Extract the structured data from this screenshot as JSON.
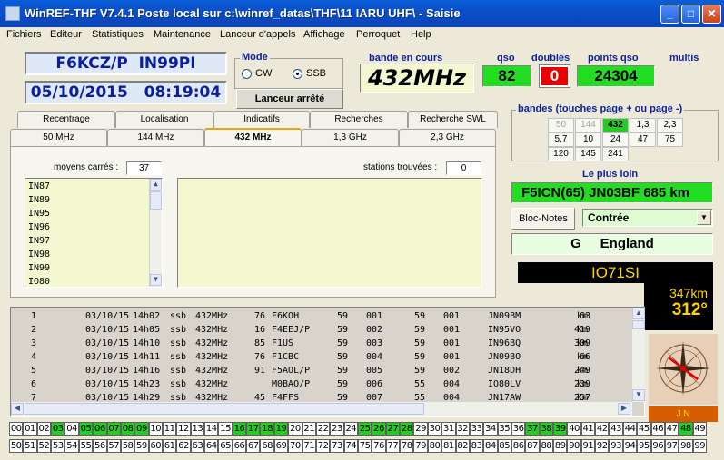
{
  "window": {
    "title": "WinREF-THF V7.4.1 Poste local sur c:\\winref_datas\\THF\\11 IARU UHF\\ -   Saisie",
    "minimize": "_",
    "maximize": "□",
    "close": "✕"
  },
  "menu": [
    "Fichiers",
    "Editeur",
    "Statistiques",
    "Maintenance",
    "Lanceur d'appels",
    "Affichage",
    "Perroquet",
    "Help"
  ],
  "station": {
    "callsign": "F6KCZ/P",
    "locator": "IN99PI",
    "date": "05/10/2015",
    "time": "08:19:04"
  },
  "mode": {
    "label": "Mode",
    "options": [
      "CW",
      "SSB"
    ],
    "selected": "SSB"
  },
  "launcher_status": "Lanceur arrêté",
  "band_current": {
    "label": "bande en cours",
    "value": "432MHz"
  },
  "qso": {
    "label": "qso",
    "value": "82"
  },
  "doubles": {
    "label": "doubles",
    "value": "0"
  },
  "points": {
    "label": "points qso",
    "value": "24304"
  },
  "multis": {
    "label": "multis"
  },
  "tabs_row1": [
    "Recentrage",
    "Localisation",
    "Indicatifs",
    "Recherches",
    "Recherche SWL"
  ],
  "tabs_row2": [
    "50 MHz",
    "144 MHz",
    "432 MHz",
    "1,3 GHz",
    "2,3 GHz"
  ],
  "active_tab": "432 MHz",
  "squares": {
    "label": "moyens carrés :",
    "count": "37",
    "items": [
      "IN87",
      "IN89",
      "IN95",
      "IN96",
      "IN97",
      "IN98",
      "IN99",
      "IO80"
    ]
  },
  "stations": {
    "label": "stations trouvées :",
    "count": "0"
  },
  "bands": {
    "label": "bandes (touches page + ou page -)",
    "cells": [
      {
        "v": "50",
        "state": "dim"
      },
      {
        "v": "144",
        "state": "dim"
      },
      {
        "v": "432",
        "state": "sel"
      },
      {
        "v": "1,3",
        "state": ""
      },
      {
        "v": "2,3",
        "state": ""
      },
      {
        "v": "5,7",
        "state": ""
      },
      {
        "v": "10",
        "state": ""
      },
      {
        "v": "24",
        "state": ""
      },
      {
        "v": "47",
        "state": ""
      },
      {
        "v": "75",
        "state": ""
      },
      {
        "v": "120",
        "state": ""
      },
      {
        "v": "145",
        "state": ""
      },
      {
        "v": "241",
        "state": ""
      }
    ]
  },
  "farthest": {
    "label": "Le plus loin",
    "value": "F5ICN(65) JN03BF  685 km"
  },
  "notes_button": "Bloc-Notes",
  "contest_select": "Contrée",
  "country": "G     England",
  "target": {
    "locator": "IO71SI",
    "distance": "347km",
    "bearing": "312°"
  },
  "compass_label": "J N",
  "log": [
    {
      "n": "1",
      "date": "03/10/15",
      "time": "14h02",
      "mode": "ssb",
      "band": "432MHz",
      "dx": "76",
      "call": "F6KOH",
      "rs": "59",
      "ns": "001",
      "rr": "59",
      "nr": "001",
      "loc": "JN09BM",
      "km": "63",
      "unit": "km"
    },
    {
      "n": "2",
      "date": "03/10/15",
      "time": "14h05",
      "mode": "ssb",
      "band": "432MHz",
      "dx": "16",
      "call": "F4EEJ/P",
      "rs": "59",
      "ns": "002",
      "rr": "59",
      "nr": "001",
      "loc": "IN95VO",
      "km": "419",
      "unit": "km"
    },
    {
      "n": "3",
      "date": "03/10/15",
      "time": "14h10",
      "mode": "ssb",
      "band": "432MHz",
      "dx": "85",
      "call": "F1US",
      "rs": "59",
      "ns": "003",
      "rr": "59",
      "nr": "001",
      "loc": "IN96BQ",
      "km": "309",
      "unit": "km"
    },
    {
      "n": "4",
      "date": "03/10/15",
      "time": "14h11",
      "mode": "ssb",
      "band": "432MHz",
      "dx": "76",
      "call": "F1CBC",
      "rs": "59",
      "ns": "004",
      "rr": "59",
      "nr": "001",
      "loc": "JN09BO",
      "km": "66",
      "unit": "km"
    },
    {
      "n": "5",
      "date": "03/10/15",
      "time": "14h16",
      "mode": "ssb",
      "band": "432MHz",
      "dx": "91",
      "call": "F5AOL/P",
      "rs": "59",
      "ns": "005",
      "rr": "59",
      "nr": "002",
      "loc": "JN18DH",
      "km": "249",
      "unit": "km"
    },
    {
      "n": "6",
      "date": "03/10/15",
      "time": "14h23",
      "mode": "ssb",
      "band": "432MHz",
      "dx": "",
      "call": "M0BAO/P",
      "rs": "59",
      "ns": "006",
      "rr": "55",
      "nr": "004",
      "loc": "IO80LV",
      "km": "239",
      "unit": "km"
    },
    {
      "n": "7",
      "date": "03/10/15",
      "time": "14h29",
      "mode": "ssb",
      "band": "432MHz",
      "dx": "45",
      "call": "F4FFS",
      "rs": "59",
      "ns": "007",
      "rr": "55",
      "nr": "004",
      "loc": "JN17AW",
      "km": "257",
      "unit": "km"
    }
  ],
  "dept_on": [
    "03",
    "05",
    "06",
    "07",
    "08",
    "09",
    "16",
    "17",
    "18",
    "19",
    "25",
    "26",
    "27",
    "28",
    "37",
    "38",
    "39",
    "48"
  ],
  "dept_row1": [
    "00",
    "01",
    "02",
    "03",
    "04",
    "05",
    "06",
    "07",
    "08",
    "09",
    "10",
    "11",
    "12",
    "13",
    "14",
    "15",
    "16",
    "17",
    "18",
    "19",
    "20",
    "21",
    "22",
    "23",
    "24",
    "25",
    "26",
    "27",
    "28",
    "29",
    "30",
    "31",
    "32",
    "33",
    "34",
    "35",
    "36",
    "37",
    "38",
    "39",
    "40",
    "41",
    "42",
    "43",
    "44",
    "45",
    "46",
    "47",
    "48",
    "49"
  ],
  "dept_row2": [
    "50",
    "51",
    "52",
    "53",
    "54",
    "55",
    "56",
    "57",
    "58",
    "59",
    "60",
    "61",
    "62",
    "63",
    "64",
    "65",
    "66",
    "67",
    "68",
    "69",
    "70",
    "71",
    "72",
    "73",
    "74",
    "75",
    "76",
    "77",
    "78",
    "79",
    "80",
    "81",
    "82",
    "83",
    "84",
    "85",
    "86",
    "87",
    "88",
    "89",
    "90",
    "91",
    "92",
    "93",
    "94",
    "95",
    "96",
    "97",
    "98",
    "99"
  ]
}
